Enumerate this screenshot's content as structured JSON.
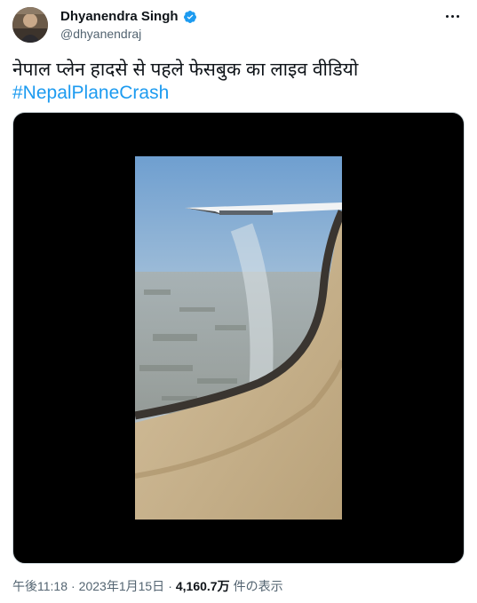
{
  "author": {
    "name": "Dhyanendra Singh",
    "handle": "@dhyanendraj",
    "verified": true
  },
  "tweet": {
    "text": "नेपाल प्लेन हादसे से पहले फेसबुक का लाइव वीडियो",
    "hashtag": "#NepalPlaneCrash"
  },
  "meta": {
    "time": "午後11:18",
    "separator": "·",
    "date": "2023年1月15日",
    "views": "4,160.7万",
    "views_label": "件の表示"
  },
  "colors": {
    "accent": "#1d9bf0",
    "text": "#0f1419",
    "secondary": "#536471"
  },
  "icons": {
    "verified": "verified-badge-icon",
    "more": "more-options-icon"
  }
}
